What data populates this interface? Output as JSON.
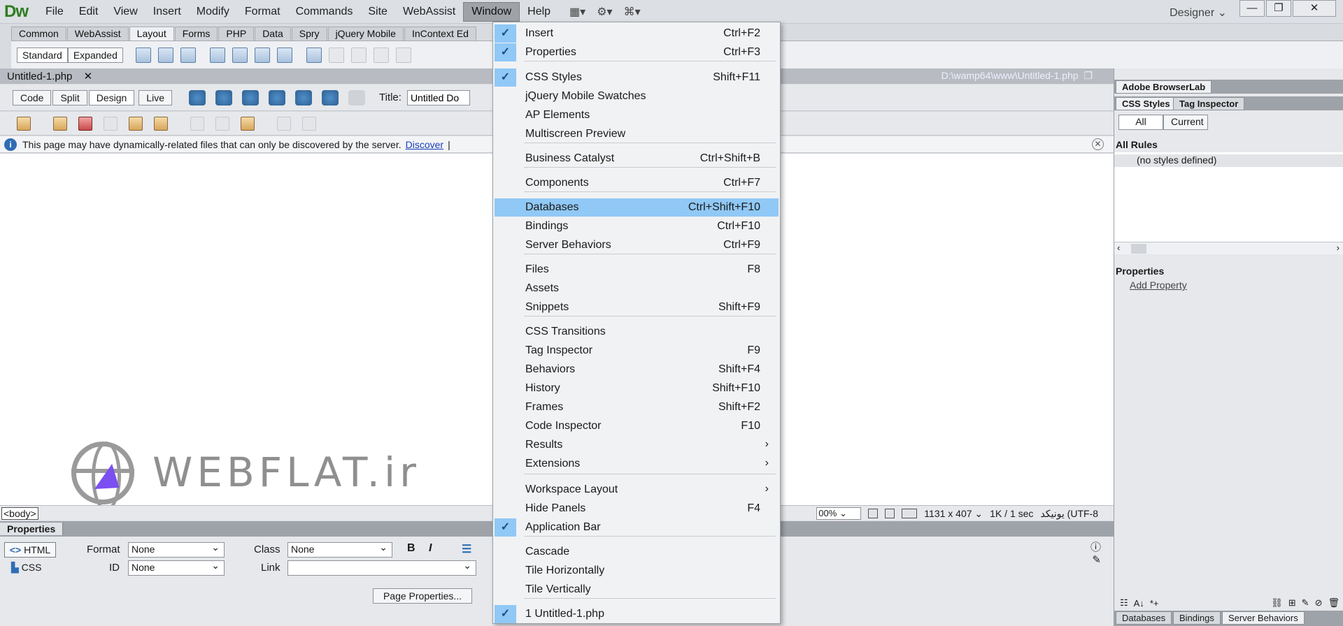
{
  "app": {
    "logo": "Dw",
    "menus": [
      "File",
      "Edit",
      "View",
      "Insert",
      "Modify",
      "Format",
      "Commands",
      "Site",
      "WebAssist",
      "Window",
      "Help"
    ],
    "workspace": "Designer",
    "window_controls": {
      "minimize": "—",
      "restore": "❐",
      "close": "✕"
    }
  },
  "insert_bar": {
    "tabs": [
      "Common",
      "WebAssist",
      "Layout",
      "Forms",
      "PHP",
      "Data",
      "Spry",
      "jQuery Mobile",
      "InContext Ed"
    ],
    "standard": "Standard",
    "expanded": "Expanded"
  },
  "document": {
    "tab_name": "Untitled-1.php",
    "tab_close": "✕",
    "path": "D:\\wamp64\\www\\Untitled-1.php",
    "view_buttons": [
      "Code",
      "Split",
      "Design",
      "Live"
    ],
    "title_label": "Title:",
    "title_value": "Untitled Do",
    "info_message": "This page may have dynamically-related files that can only be discovered by the server.",
    "discover_link": "Discover",
    "info_sep": "|"
  },
  "watermark": {
    "text": "WEBFLAT.ir"
  },
  "status_bar": {
    "tag": "<body>",
    "zoom": "00%",
    "size": "1131 x 407",
    "download": "1K / 1 sec",
    "encoding": "یونیکد (UTF-8"
  },
  "properties": {
    "title": "Properties",
    "html_btn": "HTML",
    "css_btn": "CSS",
    "format_label": "Format",
    "format_value": "None",
    "class_label": "Class",
    "class_value": "None",
    "id_label": "ID",
    "id_value": "None",
    "link_label": "Link",
    "link_value": "",
    "bold": "B",
    "italic": "I",
    "page_properties": "Page Properties..."
  },
  "right_panel": {
    "browserlab": "Adobe BrowserLab",
    "tabs": [
      "CSS Styles",
      "Tag Inspector"
    ],
    "all": "All",
    "current": "Current",
    "all_rules": "All Rules",
    "no_styles": "(no styles defined)",
    "properties": "Properties",
    "add_property": "Add Property",
    "bottom_tabs": [
      "Databases",
      "Bindings",
      "Server Behaviors"
    ]
  },
  "window_menu": [
    {
      "label": "Insert",
      "shortcut": "Ctrl+F2",
      "checked": true
    },
    {
      "label": "Properties",
      "shortcut": "Ctrl+F3",
      "checked": true
    },
    {
      "label": "CSS Styles",
      "shortcut": "Shift+F11",
      "checked": true
    },
    {
      "label": "jQuery Mobile Swatches",
      "shortcut": ""
    },
    {
      "label": "AP Elements",
      "shortcut": ""
    },
    {
      "label": "Multiscreen Preview",
      "shortcut": ""
    },
    {
      "label": "Business Catalyst",
      "shortcut": "Ctrl+Shift+B"
    },
    {
      "label": "Components",
      "shortcut": "Ctrl+F7"
    },
    {
      "label": "Databases",
      "shortcut": "Ctrl+Shift+F10",
      "highlighted": true
    },
    {
      "label": "Bindings",
      "shortcut": "Ctrl+F10"
    },
    {
      "label": "Server Behaviors",
      "shortcut": "Ctrl+F9"
    },
    {
      "label": "Files",
      "shortcut": "F8"
    },
    {
      "label": "Assets",
      "shortcut": ""
    },
    {
      "label": "Snippets",
      "shortcut": "Shift+F9"
    },
    {
      "label": "CSS Transitions",
      "shortcut": ""
    },
    {
      "label": "Tag Inspector",
      "shortcut": "F9"
    },
    {
      "label": "Behaviors",
      "shortcut": "Shift+F4"
    },
    {
      "label": "History",
      "shortcut": "Shift+F10"
    },
    {
      "label": "Frames",
      "shortcut": "Shift+F2"
    },
    {
      "label": "Code Inspector",
      "shortcut": "F10"
    },
    {
      "label": "Results",
      "submenu": true
    },
    {
      "label": "Extensions",
      "submenu": true
    },
    {
      "label": "Workspace Layout",
      "submenu": true
    },
    {
      "label": "Hide Panels",
      "shortcut": "F4"
    },
    {
      "label": "Application Bar",
      "shortcut": "",
      "checked": true
    },
    {
      "label": "Cascade",
      "shortcut": ""
    },
    {
      "label": "Tile Horizontally",
      "shortcut": ""
    },
    {
      "label": "Tile Vertically",
      "shortcut": ""
    },
    {
      "label": "1 Untitled-1.php",
      "shortcut": "",
      "checked": true
    }
  ]
}
